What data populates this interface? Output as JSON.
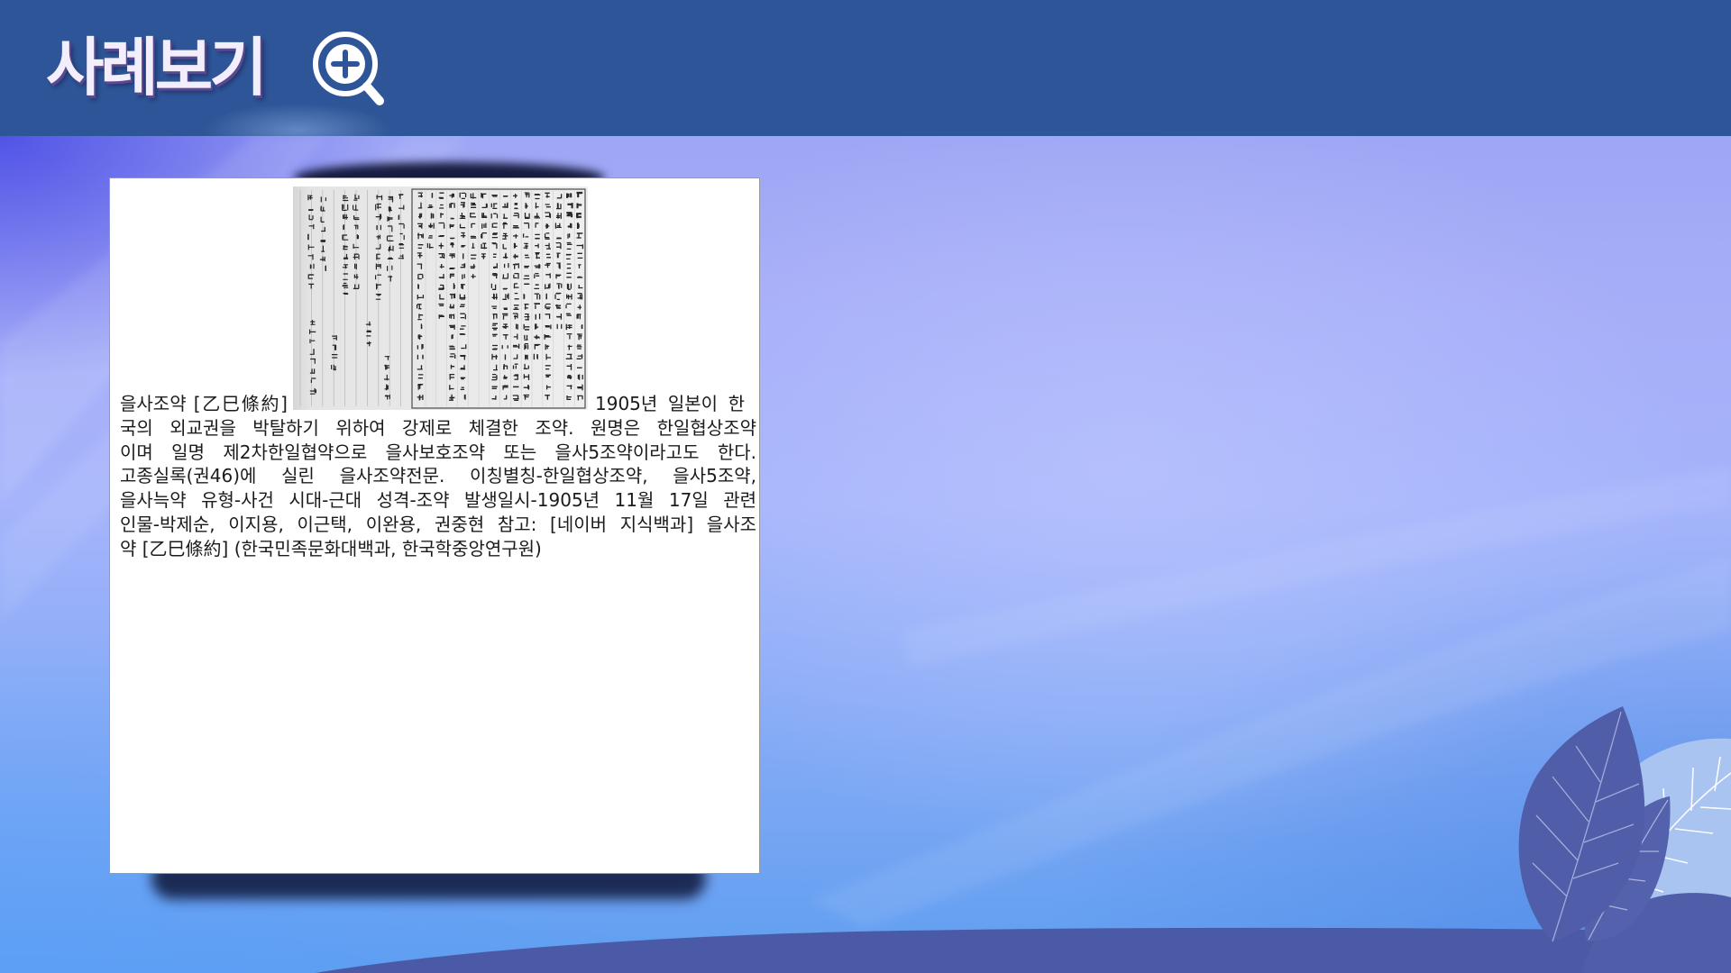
{
  "header": {
    "title": "사례보기",
    "icon": "zoom-in-icon"
  },
  "card": {
    "line1_left": "을사조약 [乙巳條約]",
    "line1_right": "1905년 일본이 한",
    "lines": [
      "국의 외교권을 박탈하기 위하여 강제로 체결한 조약. 원명은 한일협상조약",
      "이며 일명 제2차한일협약으로 을사보호조약 또는 을사5조약이라고도 한다.",
      "고종실록(권46)에 실린 을사조약전문. 이칭별칭-한일협상조약, 을사5조약,",
      "을사늑약 유형-사건 시대-근대 성격-조약 발생일시-1905년 11월 17일 관련",
      "인물-박제순, 이지용, 이근택, 이완용, 권중현 참고: [네이버 지식백과] 을사조",
      "약 [乙巳條約] (한국민족문화대백과, 한국학중앙연구원)"
    ]
  },
  "colors": {
    "header": "#2e5597",
    "title": "#f3eefc",
    "title_shadow": "#5a4890",
    "card_border": "#9a9a9a",
    "text": "#1b1b1b",
    "wave": "#4b5aa6",
    "leaf_dark": "#505ea9",
    "leaf_light": "#a9c4f0"
  }
}
